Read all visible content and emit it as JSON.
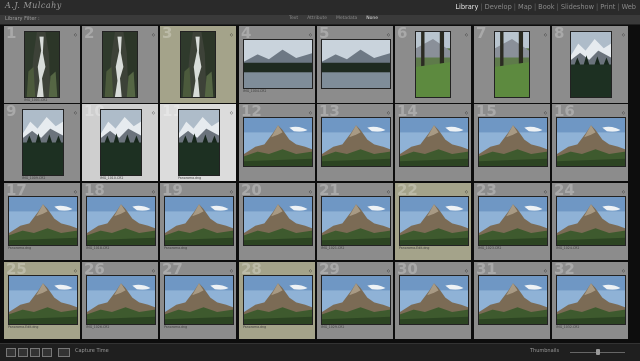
{
  "app": {
    "logo_text": "A.J. Mulcahy",
    "modules": [
      "Library",
      "Develop",
      "Map",
      "Book",
      "Slideshow",
      "Print",
      "Web"
    ],
    "active_module": "Library"
  },
  "filter_bar": {
    "title": "Library Filter :",
    "items": [
      "Text",
      "Attribute",
      "Metadata",
      "None"
    ],
    "active": "None"
  },
  "toolbar": {
    "sort_label": "Capture Time",
    "thumbnails_label": "Thumbnails"
  },
  "thumbnails": [
    {
      "num": "1",
      "type": "waterfall",
      "caption": "",
      "label": "IMG_1001.CR2",
      "state": "normal"
    },
    {
      "num": "2",
      "type": "waterfall",
      "caption": "",
      "label": "",
      "state": "normal"
    },
    {
      "num": "3",
      "type": "waterfall",
      "caption": "",
      "label": "",
      "state": "selected"
    },
    {
      "num": "4",
      "type": "lake",
      "caption": "",
      "label": "IMG_1004.CR2",
      "state": "normal"
    },
    {
      "num": "5",
      "type": "lake",
      "caption": "",
      "label": "",
      "state": "normal"
    },
    {
      "num": "6",
      "type": "forest",
      "caption": "",
      "label": "",
      "state": "normal"
    },
    {
      "num": "7",
      "type": "forest",
      "caption": "",
      "label": "",
      "state": "normal"
    },
    {
      "num": "8",
      "type": "snowtrees",
      "caption": "",
      "label": "",
      "state": "normal"
    },
    {
      "num": "9",
      "type": "snowtrees",
      "caption": "",
      "label": "IMG_1009.CR2",
      "state": "normal"
    },
    {
      "num": "10",
      "type": "snowtrees",
      "caption": "",
      "label": "IMG_1010.CR2",
      "state": "primary"
    },
    {
      "num": "11",
      "type": "snowtrees",
      "caption": "",
      "label": "Panorama.dng",
      "state": "primary-selected"
    },
    {
      "num": "12",
      "type": "peak",
      "caption": "",
      "label": "",
      "state": "normal"
    },
    {
      "num": "13",
      "type": "peak",
      "caption": "",
      "label": "",
      "state": "normal"
    },
    {
      "num": "14",
      "type": "peak",
      "caption": "",
      "label": "",
      "state": "normal"
    },
    {
      "num": "15",
      "type": "peak",
      "caption": "",
      "label": "",
      "state": "normal"
    },
    {
      "num": "16",
      "type": "peak",
      "caption": "",
      "label": "",
      "state": "normal"
    },
    {
      "num": "17",
      "type": "peak",
      "caption": "",
      "label": "Panorama.dng",
      "state": "normal"
    },
    {
      "num": "18",
      "type": "peak",
      "caption": "",
      "label": "IMG_1018.CR2",
      "state": "normal"
    },
    {
      "num": "19",
      "type": "peak",
      "caption": "",
      "label": "Panorama.dng",
      "state": "normal"
    },
    {
      "num": "20",
      "type": "peak",
      "caption": "",
      "label": "",
      "state": "normal"
    },
    {
      "num": "21",
      "type": "peak",
      "caption": "",
      "label": "IMG_1021.CR2",
      "state": "normal"
    },
    {
      "num": "22",
      "type": "peak",
      "caption": "",
      "label": "Panorama-Edit.dng",
      "state": "selected"
    },
    {
      "num": "23",
      "type": "peak",
      "caption": "",
      "label": "IMG_1023.CR2",
      "state": "normal"
    },
    {
      "num": "24",
      "type": "peak",
      "caption": "",
      "label": "IMG_1024.CR2",
      "state": "normal"
    },
    {
      "num": "25",
      "type": "peak",
      "caption": "",
      "label": "Panorama-Edit.dng",
      "state": "selected"
    },
    {
      "num": "26",
      "type": "peak",
      "caption": "",
      "label": "IMG_1026.CR2",
      "state": "normal"
    },
    {
      "num": "27",
      "type": "peak",
      "caption": "",
      "label": "Panorama.dng",
      "state": "normal"
    },
    {
      "num": "28",
      "type": "peak",
      "caption": "",
      "label": "Panorama.dng",
      "state": "selected"
    },
    {
      "num": "29",
      "type": "peak",
      "caption": "",
      "label": "IMG_1029.CR2",
      "state": "normal"
    },
    {
      "num": "30",
      "type": "peak",
      "caption": "",
      "label": "",
      "state": "normal"
    },
    {
      "num": "31",
      "type": "peak",
      "caption": "",
      "label": "",
      "state": "normal"
    },
    {
      "num": "32",
      "type": "peak",
      "caption": "",
      "label": "IMG_1032.CR2",
      "state": "normal"
    }
  ]
}
